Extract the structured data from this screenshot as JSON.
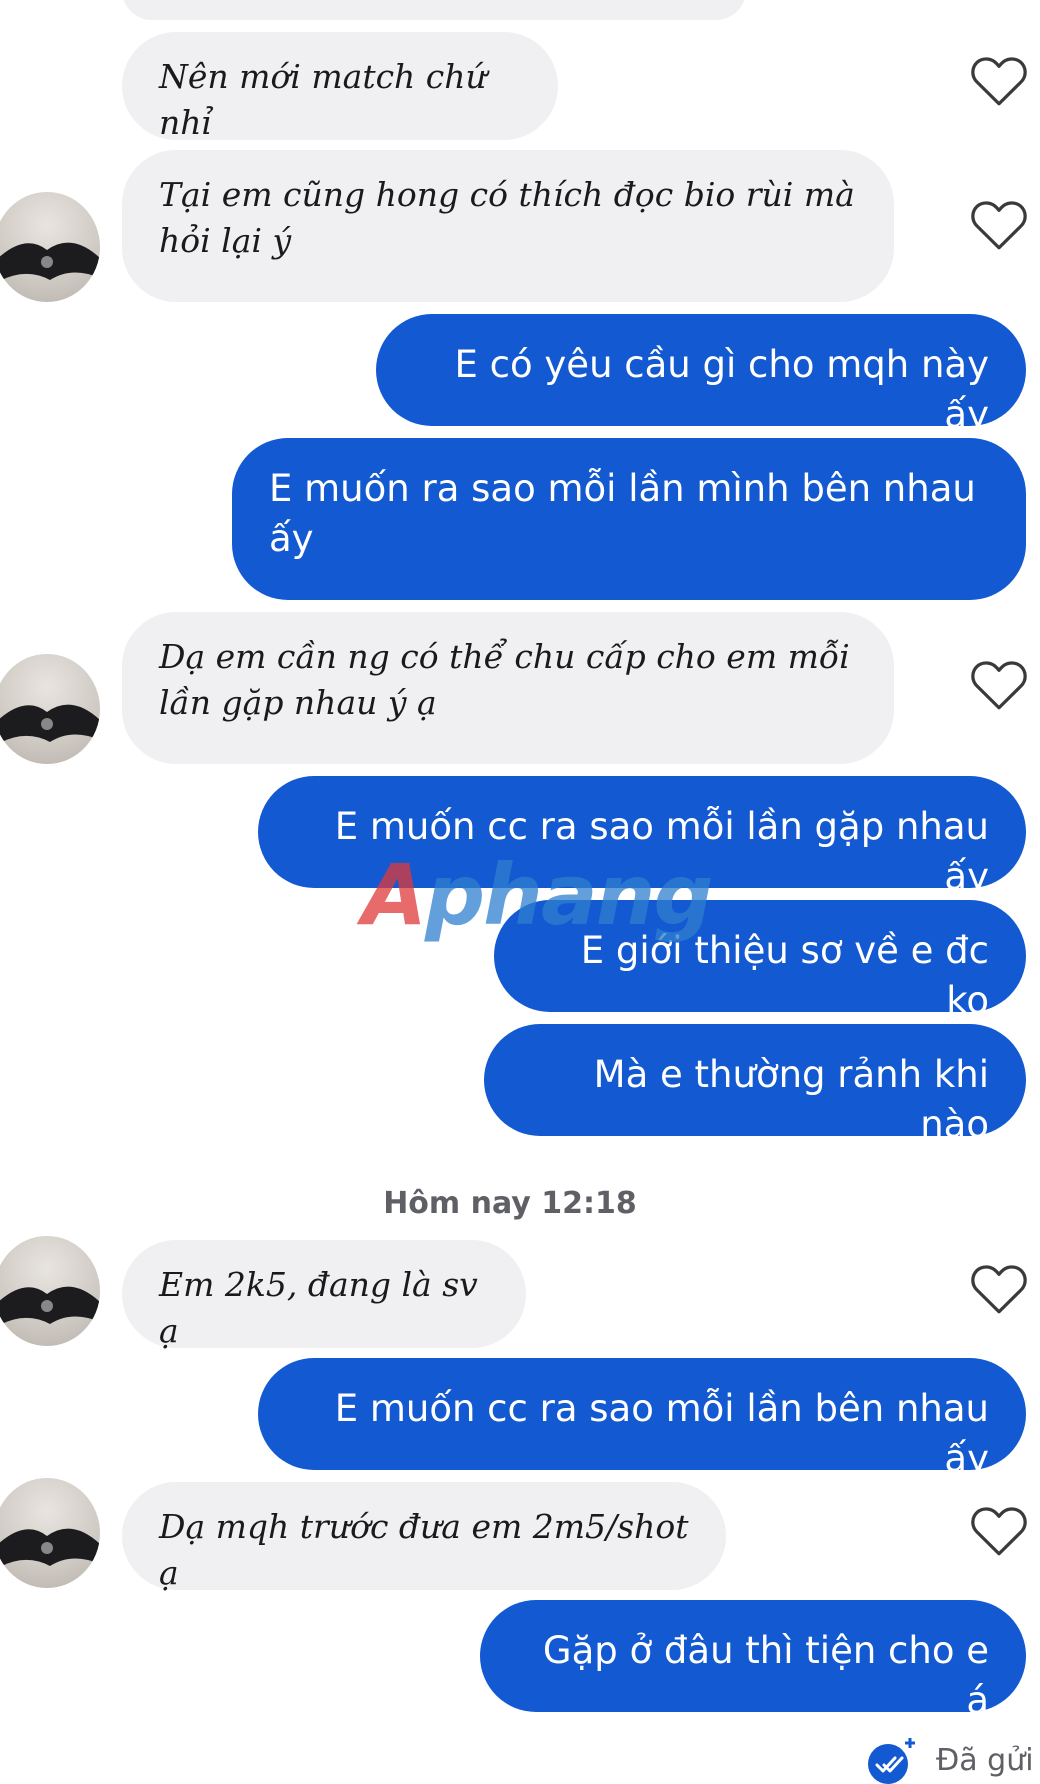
{
  "messages": [
    {
      "from": "them",
      "text": "Nên mới match chứ nhỉ"
    },
    {
      "from": "them",
      "text": "Tại em cũng hong có thích đọc bio rùi mà hỏi lại ý"
    },
    {
      "from": "me",
      "text": "E có yêu cầu gì cho mqh này ấy"
    },
    {
      "from": "me",
      "text": "E muốn ra sao mỗi lần mình bên nhau ấy"
    },
    {
      "from": "them",
      "text": "Dạ em cần ng có thể chu cấp cho em mỗi lần gặp nhau ý ạ"
    },
    {
      "from": "me",
      "text": "E muốn cc ra sao mỗi lần gặp nhau ấy"
    },
    {
      "from": "me",
      "text": "E giới thiệu sơ về e đc ko"
    },
    {
      "from": "me",
      "text": "Mà e thường rảnh khi nào"
    },
    {
      "from": "them",
      "text": "Em 2k5, đang là sv ạ"
    },
    {
      "from": "me",
      "text": "E muốn cc ra sao mỗi lần bên nhau ấy"
    },
    {
      "from": "them",
      "text": "Dạ mqh trước đưa em 2m5/shot ạ"
    },
    {
      "from": "me",
      "text": "Gặp ở đâu thì tiện cho e á"
    }
  ],
  "timestamp": "Hôm nay 12:18",
  "status": "Đã gửi",
  "watermark": {
    "part1": "A",
    "part2": "phang"
  },
  "colors": {
    "outgoing_bubble": "#1359d1",
    "incoming_bubble": "#f0f0f2",
    "meta_text": "#5f5f66"
  },
  "icons": {
    "like": "heart-outline-icon",
    "delivered": "double-check-icon"
  }
}
